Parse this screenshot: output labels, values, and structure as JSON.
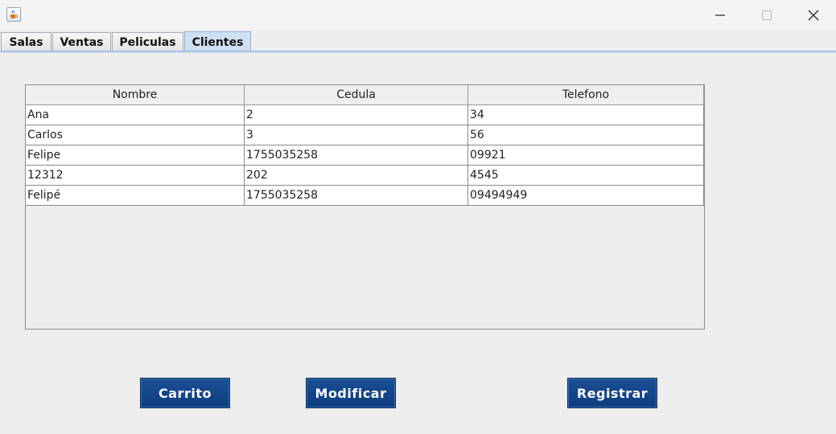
{
  "window": {
    "icon": "java-cup-icon",
    "controls": {
      "minimize": "minimize-icon",
      "maximize": "maximize-icon",
      "close": "close-icon"
    }
  },
  "tabs": [
    {
      "label": "Salas",
      "selected": false
    },
    {
      "label": "Ventas",
      "selected": false
    },
    {
      "label": "Peliculas",
      "selected": false
    },
    {
      "label": "Clientes",
      "selected": true
    }
  ],
  "table": {
    "columns": [
      "Nombre",
      "Cedula",
      "Telefono"
    ],
    "rows": [
      [
        "Ana",
        "2",
        "34"
      ],
      [
        "Carlos",
        "3",
        "56"
      ],
      [
        "Felipe",
        "1755035258",
        "09921"
      ],
      [
        "12312",
        "202",
        "4545"
      ],
      [
        "Felipé",
        "1755035258",
        "09494949"
      ]
    ]
  },
  "buttons": {
    "carrito": "Carrito",
    "modificar": "Modificar",
    "registrar": "Registrar"
  },
  "colors": {
    "accent_button": "#0e3d7e",
    "selected_tab": "#cfe0f3",
    "background": "#eeeeee"
  }
}
